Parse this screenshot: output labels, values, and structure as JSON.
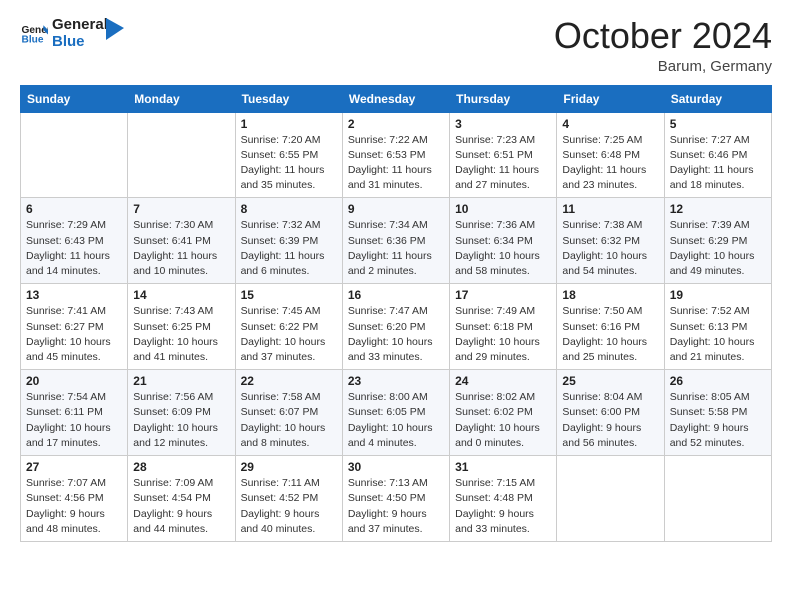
{
  "logo": {
    "line1": "General",
    "line2": "Blue"
  },
  "header": {
    "month": "October 2024",
    "location": "Barum, Germany"
  },
  "weekdays": [
    "Sunday",
    "Monday",
    "Tuesday",
    "Wednesday",
    "Thursday",
    "Friday",
    "Saturday"
  ],
  "weeks": [
    [
      {
        "day": "",
        "info": ""
      },
      {
        "day": "",
        "info": ""
      },
      {
        "day": "1",
        "info": "Sunrise: 7:20 AM\nSunset: 6:55 PM\nDaylight: 11 hours and 35 minutes."
      },
      {
        "day": "2",
        "info": "Sunrise: 7:22 AM\nSunset: 6:53 PM\nDaylight: 11 hours and 31 minutes."
      },
      {
        "day": "3",
        "info": "Sunrise: 7:23 AM\nSunset: 6:51 PM\nDaylight: 11 hours and 27 minutes."
      },
      {
        "day": "4",
        "info": "Sunrise: 7:25 AM\nSunset: 6:48 PM\nDaylight: 11 hours and 23 minutes."
      },
      {
        "day": "5",
        "info": "Sunrise: 7:27 AM\nSunset: 6:46 PM\nDaylight: 11 hours and 18 minutes."
      }
    ],
    [
      {
        "day": "6",
        "info": "Sunrise: 7:29 AM\nSunset: 6:43 PM\nDaylight: 11 hours and 14 minutes."
      },
      {
        "day": "7",
        "info": "Sunrise: 7:30 AM\nSunset: 6:41 PM\nDaylight: 11 hours and 10 minutes."
      },
      {
        "day": "8",
        "info": "Sunrise: 7:32 AM\nSunset: 6:39 PM\nDaylight: 11 hours and 6 minutes."
      },
      {
        "day": "9",
        "info": "Sunrise: 7:34 AM\nSunset: 6:36 PM\nDaylight: 11 hours and 2 minutes."
      },
      {
        "day": "10",
        "info": "Sunrise: 7:36 AM\nSunset: 6:34 PM\nDaylight: 10 hours and 58 minutes."
      },
      {
        "day": "11",
        "info": "Sunrise: 7:38 AM\nSunset: 6:32 PM\nDaylight: 10 hours and 54 minutes."
      },
      {
        "day": "12",
        "info": "Sunrise: 7:39 AM\nSunset: 6:29 PM\nDaylight: 10 hours and 49 minutes."
      }
    ],
    [
      {
        "day": "13",
        "info": "Sunrise: 7:41 AM\nSunset: 6:27 PM\nDaylight: 10 hours and 45 minutes."
      },
      {
        "day": "14",
        "info": "Sunrise: 7:43 AM\nSunset: 6:25 PM\nDaylight: 10 hours and 41 minutes."
      },
      {
        "day": "15",
        "info": "Sunrise: 7:45 AM\nSunset: 6:22 PM\nDaylight: 10 hours and 37 minutes."
      },
      {
        "day": "16",
        "info": "Sunrise: 7:47 AM\nSunset: 6:20 PM\nDaylight: 10 hours and 33 minutes."
      },
      {
        "day": "17",
        "info": "Sunrise: 7:49 AM\nSunset: 6:18 PM\nDaylight: 10 hours and 29 minutes."
      },
      {
        "day": "18",
        "info": "Sunrise: 7:50 AM\nSunset: 6:16 PM\nDaylight: 10 hours and 25 minutes."
      },
      {
        "day": "19",
        "info": "Sunrise: 7:52 AM\nSunset: 6:13 PM\nDaylight: 10 hours and 21 minutes."
      }
    ],
    [
      {
        "day": "20",
        "info": "Sunrise: 7:54 AM\nSunset: 6:11 PM\nDaylight: 10 hours and 17 minutes."
      },
      {
        "day": "21",
        "info": "Sunrise: 7:56 AM\nSunset: 6:09 PM\nDaylight: 10 hours and 12 minutes."
      },
      {
        "day": "22",
        "info": "Sunrise: 7:58 AM\nSunset: 6:07 PM\nDaylight: 10 hours and 8 minutes."
      },
      {
        "day": "23",
        "info": "Sunrise: 8:00 AM\nSunset: 6:05 PM\nDaylight: 10 hours and 4 minutes."
      },
      {
        "day": "24",
        "info": "Sunrise: 8:02 AM\nSunset: 6:02 PM\nDaylight: 10 hours and 0 minutes."
      },
      {
        "day": "25",
        "info": "Sunrise: 8:04 AM\nSunset: 6:00 PM\nDaylight: 9 hours and 56 minutes."
      },
      {
        "day": "26",
        "info": "Sunrise: 8:05 AM\nSunset: 5:58 PM\nDaylight: 9 hours and 52 minutes."
      }
    ],
    [
      {
        "day": "27",
        "info": "Sunrise: 7:07 AM\nSunset: 4:56 PM\nDaylight: 9 hours and 48 minutes."
      },
      {
        "day": "28",
        "info": "Sunrise: 7:09 AM\nSunset: 4:54 PM\nDaylight: 9 hours and 44 minutes."
      },
      {
        "day": "29",
        "info": "Sunrise: 7:11 AM\nSunset: 4:52 PM\nDaylight: 9 hours and 40 minutes."
      },
      {
        "day": "30",
        "info": "Sunrise: 7:13 AM\nSunset: 4:50 PM\nDaylight: 9 hours and 37 minutes."
      },
      {
        "day": "31",
        "info": "Sunrise: 7:15 AM\nSunset: 4:48 PM\nDaylight: 9 hours and 33 minutes."
      },
      {
        "day": "",
        "info": ""
      },
      {
        "day": "",
        "info": ""
      }
    ]
  ]
}
